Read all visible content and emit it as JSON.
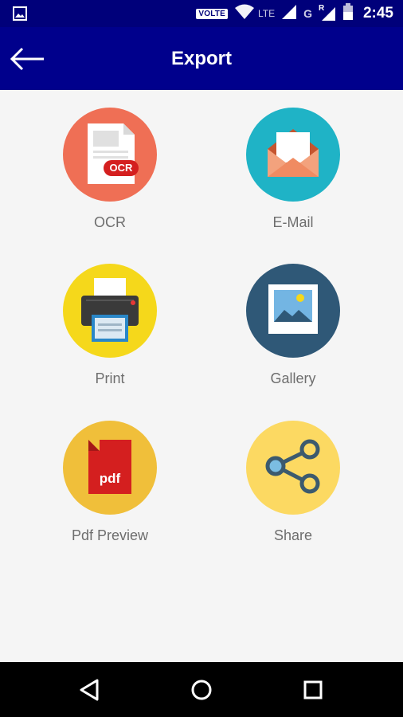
{
  "status_bar": {
    "volte": "VOLTE",
    "network": "LTE",
    "second_network": "G",
    "roaming": "R",
    "time": "2:45",
    "left_icon": "image-notification-icon"
  },
  "app_bar": {
    "title": "Export",
    "back_icon": "arrow-left-icon",
    "background_color": "#00008c"
  },
  "export_options": [
    {
      "label": "OCR",
      "icon": "ocr-document-icon",
      "color": "#ef6f55"
    },
    {
      "label": "E-Mail",
      "icon": "email-envelope-icon",
      "color": "#1fb3c6"
    },
    {
      "label": "Print",
      "icon": "printer-icon",
      "color": "#f5d81b"
    },
    {
      "label": "Gallery",
      "icon": "gallery-picture-icon",
      "color": "#2f5877"
    },
    {
      "label": "Pdf Preview",
      "icon": "pdf-file-icon",
      "color": "#f0bf3a"
    },
    {
      "label": "Share",
      "icon": "share-icon",
      "color": "#fcd962"
    }
  ],
  "ocr_badge_text": "OCR",
  "pdf_badge_text": "pdf",
  "nav_bar": {
    "back": "triangle-back-icon",
    "home": "circle-home-icon",
    "recents": "square-recents-icon"
  }
}
